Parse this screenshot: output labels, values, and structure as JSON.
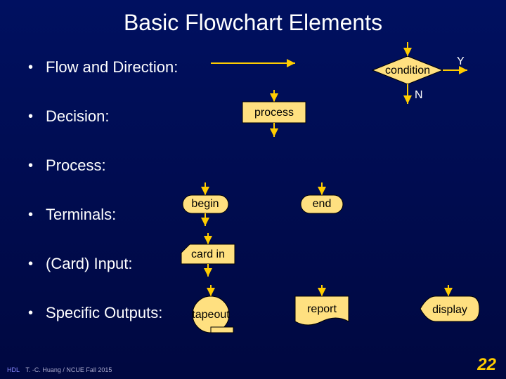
{
  "title": "Basic Flowchart Elements",
  "items": [
    {
      "label": "Flow and Direction:"
    },
    {
      "label": "Decision:"
    },
    {
      "label": "Process:"
    },
    {
      "label": "Terminals:"
    },
    {
      "label": "(Card) Input:"
    },
    {
      "label": "Specific Outputs:"
    }
  ],
  "shapes": {
    "condition": "condition",
    "y": "Y",
    "n": "N",
    "process": "process",
    "begin": "begin",
    "end": "end",
    "cardin": "card in",
    "tapeout": "tapeout",
    "report": "report",
    "display": "display"
  },
  "footer": {
    "hdl": "HDL",
    "credit": "T. -C. Huang / NCUE   Fall 2015"
  },
  "page": "22"
}
